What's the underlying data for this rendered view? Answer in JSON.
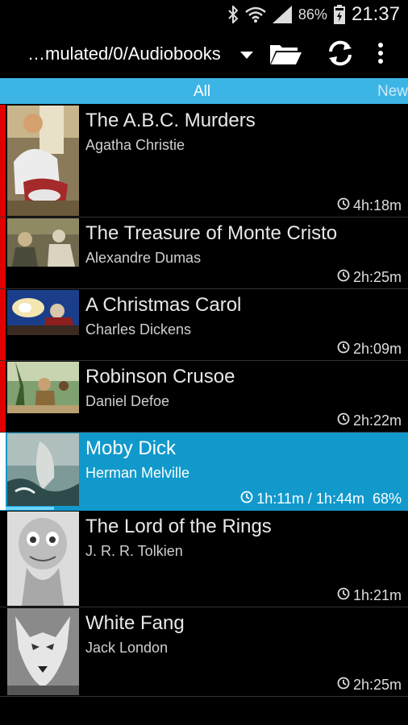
{
  "status_bar": {
    "battery": "86%",
    "time": "21:37"
  },
  "toolbar": {
    "path": "…mulated/0/Audiobooks"
  },
  "tabs": {
    "all": "All",
    "new": "New"
  },
  "books": [
    {
      "title": "The A.B.C. Murders",
      "author": "Agatha Christie",
      "duration": "4h:18m",
      "marker_color": "#e00000"
    },
    {
      "title": "The Treasure of Monte Cristo",
      "author": "Alexandre Dumas",
      "duration": "2h:25m",
      "marker_color": "#e00000"
    },
    {
      "title": "A Christmas Carol",
      "author": "Charles Dickens",
      "duration": "2h:09m",
      "marker_color": "#e00000"
    },
    {
      "title": "Robinson Crusoe",
      "author": "Daniel Defoe",
      "duration": "2h:22m",
      "marker_color": "#e00000"
    },
    {
      "title": "Moby Dick",
      "author": "Herman Melville",
      "duration": "1h:11m / 1h:44m  68%",
      "marker_color": "#ffffff",
      "progress": 0.68
    },
    {
      "title": "The Lord of the Rings",
      "author": "J. R. R. Tolkien",
      "duration": "1h:21m",
      "marker_color": "#000000"
    },
    {
      "title": "White Fang",
      "author": "Jack London",
      "duration": "2h:25m",
      "marker_color": "#000000"
    }
  ],
  "icons": [
    "bluetooth-icon",
    "wifi-icon",
    "signal-icon",
    "battery-icon",
    "folder-icon",
    "sync-icon",
    "overflow-menu-icon",
    "clock-icon"
  ]
}
